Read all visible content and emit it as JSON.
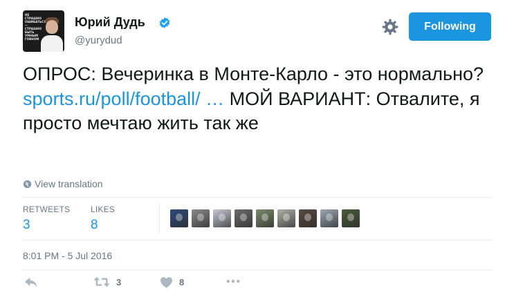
{
  "author": {
    "display_name": "Юрий Дудь",
    "username": "@yurydud",
    "avatar_caption": "НЕ СТРАШНО ОШИБАТЬСЯ — СТРАШНО БЫТЬ УМНЫМ ГОВНОМ"
  },
  "header": {
    "follow_label": "Following"
  },
  "tweet": {
    "text_before": "ОПРОС: Вечеринка в Монте-Карло - это нормально? ",
    "link": "sports.ru/poll/football/ …",
    "text_after": " МОЙ ВАРИАНТ: Отвалите, я просто мечтаю жить так же"
  },
  "translation": {
    "label": "View translation"
  },
  "stats": {
    "retweets_label": "RETWEETS",
    "retweets_count": "3",
    "likes_label": "LIKES",
    "likes_count": "8"
  },
  "likers": [
    {
      "color": "#2f4a7a"
    },
    {
      "color": "#8a8a8a"
    },
    {
      "color": "#c8c8d6"
    },
    {
      "color": "#6b6b6b"
    },
    {
      "color": "#7a8a6a"
    },
    {
      "color": "#b0b0a8"
    },
    {
      "color": "#5a4a40"
    },
    {
      "color": "#9aa7b0"
    },
    {
      "color": "#4a5a3a"
    }
  ],
  "meta": {
    "timestamp": "8:01 PM - 5 Jul 2016"
  },
  "actions": {
    "retweet_count": "3",
    "like_count": "8"
  },
  "colors": {
    "accent": "#1b95e0",
    "muted": "#657786",
    "text": "#14171a"
  }
}
